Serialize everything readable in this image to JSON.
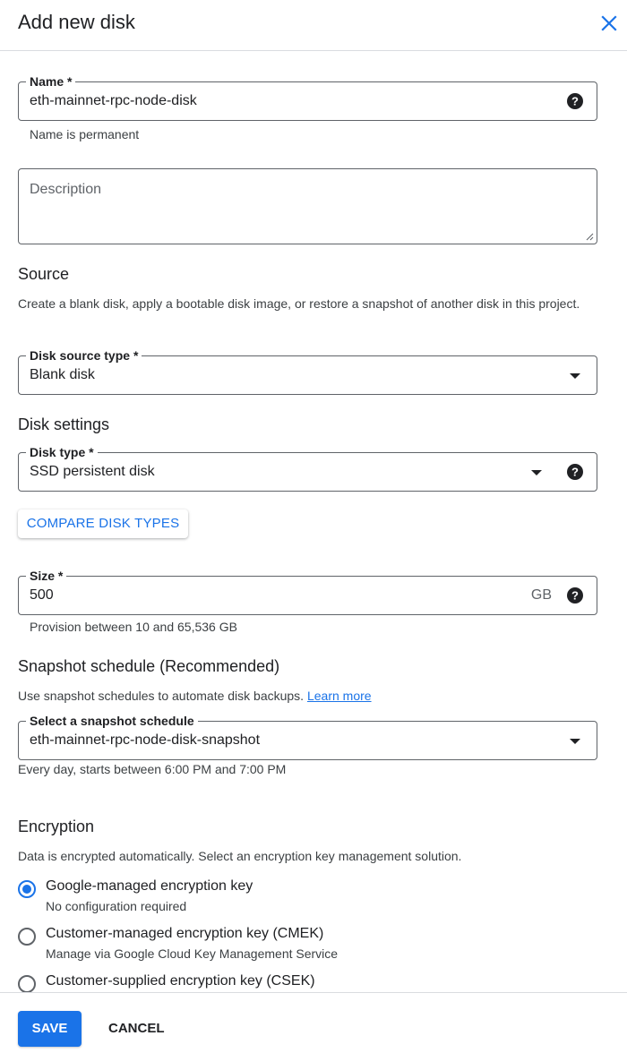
{
  "header": {
    "title": "Add new disk",
    "close_icon": "close-icon"
  },
  "colors": {
    "accent": "#1a73e8",
    "border": "#5f6368",
    "text": "#202124",
    "muted": "#3c4043"
  },
  "name_field": {
    "label": "Name *",
    "value": "eth-mainnet-rpc-node-disk",
    "hint": "Name is permanent",
    "icon": "help-icon"
  },
  "description_field": {
    "placeholder": "Description"
  },
  "source": {
    "title": "Source",
    "description": "Create a blank disk, apply a bootable disk image, or restore a snapshot of another disk in this project.",
    "source_type": {
      "label": "Disk source type *",
      "value": "Blank disk"
    }
  },
  "disk_settings": {
    "title": "Disk settings",
    "disk_type": {
      "label": "Disk type *",
      "value": "SSD persistent disk"
    },
    "compare_button": "COMPARE DISK TYPES",
    "size": {
      "label": "Size *",
      "value": "500",
      "unit": "GB",
      "hint": "Provision between 10 and 65,536 GB"
    }
  },
  "snapshot": {
    "title": "Snapshot schedule (Recommended)",
    "description": "Use snapshot schedules to automate disk backups.",
    "learn_more": "Learn more",
    "schedule": {
      "label": "Select a snapshot schedule",
      "value": "eth-mainnet-rpc-node-disk-snapshot"
    },
    "hint": "Every day, starts between 6:00 PM and 7:00 PM"
  },
  "encryption": {
    "title": "Encryption",
    "description": "Data is encrypted automatically. Select an encryption key management solution.",
    "options": [
      {
        "label": "Google-managed encryption key",
        "sub": "No configuration required",
        "checked": true
      },
      {
        "label": "Customer-managed encryption key (CMEK)",
        "sub": "Manage via Google Cloud Key Management Service",
        "checked": false
      },
      {
        "label": "Customer-supplied encryption key (CSEK)",
        "sub": "",
        "checked": false
      }
    ]
  },
  "footer": {
    "save_label": "SAVE",
    "cancel_label": "CANCEL"
  }
}
